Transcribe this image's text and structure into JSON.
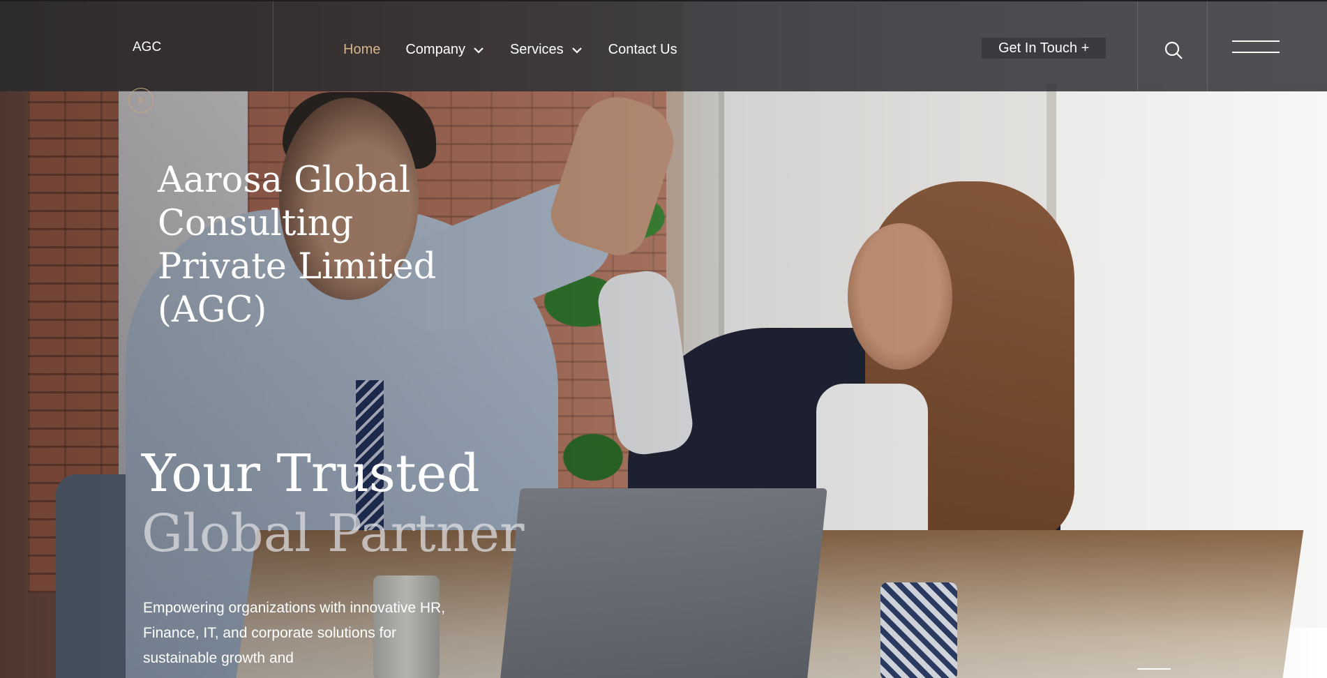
{
  "header": {
    "logo_text": "AGC",
    "nav": [
      {
        "label": "Home",
        "active": true,
        "has_dropdown": false
      },
      {
        "label": "Company",
        "active": false,
        "has_dropdown": true
      },
      {
        "label": "Services",
        "active": false,
        "has_dropdown": true
      },
      {
        "label": "Contact Us",
        "active": false,
        "has_dropdown": false
      }
    ],
    "cta_label": "Get In Touch +",
    "icons": {
      "search": "search-icon",
      "menu": "hamburger-menu-icon",
      "dropdown": "chevron-down-icon"
    }
  },
  "hero": {
    "company_name": "Aarosa Global Consulting Private Limited (AGC)",
    "tagline_line1": "Your Trusted",
    "tagline_line2": "Global Partner",
    "description": "Empowering organizations with innovative HR, Finance, IT, and corporate solutions for sustainable growth and"
  },
  "colors": {
    "accent": "#d4b48c",
    "header_bg": "#2b2d31",
    "text": "#ffffff"
  }
}
